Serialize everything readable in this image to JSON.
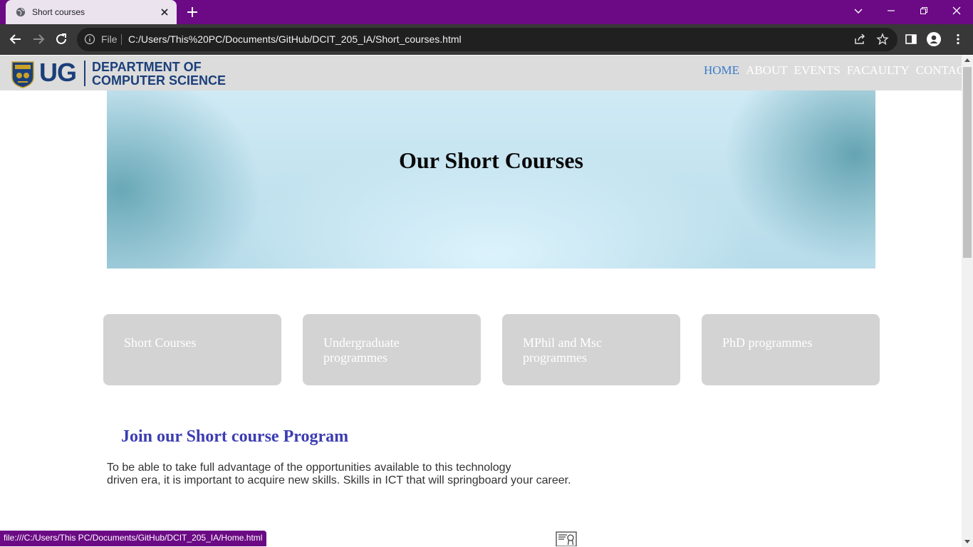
{
  "browser": {
    "tab_title": "Short courses",
    "address_scheme": "File",
    "url": "C:/Users/This%20PC/Documents/GitHub/DCIT_205_IA/Short_courses.html",
    "status_url": "file:///C:/Users/This PC/Documents/GitHub/DCIT_205_IA/Home.html",
    "theme_color": "#6b0a84"
  },
  "site": {
    "logo_text": "UG",
    "department_line1": "DEPARTMENT OF",
    "department_line2": "COMPUTER SCIENCE",
    "nav": [
      {
        "label": "HOME",
        "active": true
      },
      {
        "label": "ABOUT",
        "active": false
      },
      {
        "label": "EVENTS",
        "active": false
      },
      {
        "label": "FACAULTY",
        "active": false
      },
      {
        "label": "CONTACT",
        "active": false
      }
    ],
    "brand_color": "#1b3f7a"
  },
  "hero": {
    "title": "Our Short Courses"
  },
  "cards": [
    {
      "label": "Short Courses"
    },
    {
      "label": "Undergraduate programmes"
    },
    {
      "label": "MPhil and Msc programmes"
    },
    {
      "label": "PhD programmes"
    }
  ],
  "join": {
    "heading": "Join our Short course Program",
    "paragraph_line1": "To be able to take full advantage of the opportunities available to this technology",
    "paragraph_line2": "driven era, it is important to acquire new skills. Skills in ICT that will springboard your career."
  },
  "icons": {
    "tab_favicon": "globe-icon",
    "certificate": "certificate-icon"
  }
}
